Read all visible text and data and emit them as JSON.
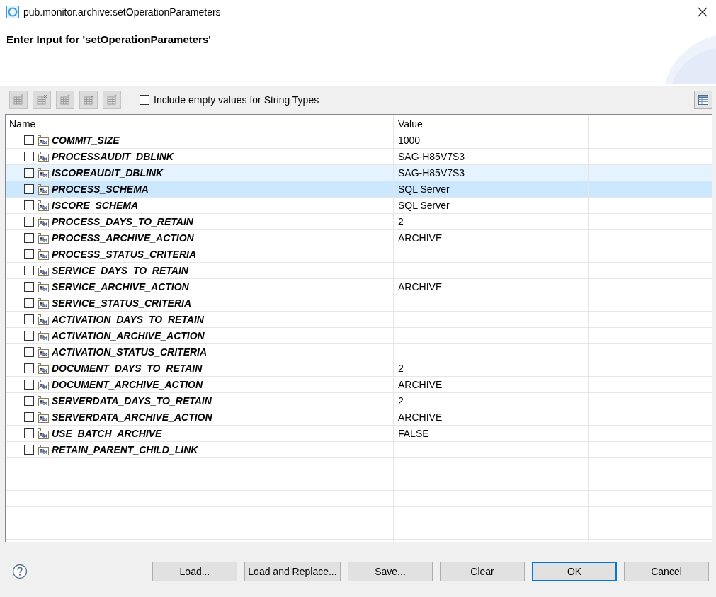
{
  "window": {
    "title": "pub.monitor.archive:setOperationParameters"
  },
  "header": {
    "title": "Enter Input for 'setOperationParameters'"
  },
  "toolbar": {
    "buttons": [
      {
        "disabled": true
      },
      {
        "disabled": true
      },
      {
        "disabled": true
      },
      {
        "disabled": true
      },
      {
        "disabled": true
      }
    ],
    "include_empty": {
      "label": "Include empty values for String Types",
      "checked": false
    }
  },
  "table": {
    "columns": [
      "Name",
      "Value"
    ],
    "rows": [
      {
        "name": "COMMIT_SIZE",
        "value": "1000",
        "checked": false,
        "selected": false,
        "hovered": false
      },
      {
        "name": "PROCESSAUDIT_DBLINK",
        "value": "SAG-H85V7S3",
        "checked": false,
        "selected": false,
        "hovered": false
      },
      {
        "name": "ISCOREAUDIT_DBLINK",
        "value": "SAG-H85V7S3",
        "checked": false,
        "selected": false,
        "hovered": true
      },
      {
        "name": "PROCESS_SCHEMA",
        "value": "SQL Server",
        "checked": false,
        "selected": true,
        "hovered": false
      },
      {
        "name": "ISCORE_SCHEMA",
        "value": "SQL Server",
        "checked": false,
        "selected": false,
        "hovered": false
      },
      {
        "name": "PROCESS_DAYS_TO_RETAIN",
        "value": "2",
        "checked": false,
        "selected": false,
        "hovered": false
      },
      {
        "name": "PROCESS_ARCHIVE_ACTION",
        "value": "ARCHIVE",
        "checked": false,
        "selected": false,
        "hovered": false
      },
      {
        "name": "PROCESS_STATUS_CRITERIA",
        "checked": false,
        "selected": false,
        "hovered": false
      },
      {
        "name": "SERVICE_DAYS_TO_RETAIN",
        "checked": false,
        "selected": false,
        "hovered": false
      },
      {
        "name": "SERVICE_ARCHIVE_ACTION",
        "value": "ARCHIVE",
        "checked": false,
        "selected": false,
        "hovered": false
      },
      {
        "name": "SERVICE_STATUS_CRITERIA",
        "checked": false,
        "selected": false,
        "hovered": false
      },
      {
        "name": "ACTIVATION_DAYS_TO_RETAIN",
        "checked": false,
        "selected": false,
        "hovered": false
      },
      {
        "name": "ACTIVATION_ARCHIVE_ACTION",
        "checked": false,
        "selected": false,
        "hovered": false
      },
      {
        "name": "ACTIVATION_STATUS_CRITERIA",
        "checked": false,
        "selected": false,
        "hovered": false
      },
      {
        "name": "DOCUMENT_DAYS_TO_RETAIN",
        "value": "2",
        "checked": false,
        "selected": false,
        "hovered": false
      },
      {
        "name": "DOCUMENT_ARCHIVE_ACTION",
        "value": "ARCHIVE",
        "checked": false,
        "selected": false,
        "hovered": false
      },
      {
        "name": "SERVERDATA_DAYS_TO_RETAIN",
        "value": "2",
        "checked": false,
        "selected": false,
        "hovered": false
      },
      {
        "name": "SERVERDATA_ARCHIVE_ACTION",
        "value": "ARCHIVE",
        "checked": false,
        "selected": false,
        "hovered": false
      },
      {
        "name": "USE_BATCH_ARCHIVE",
        "value": "FALSE",
        "checked": false,
        "selected": false,
        "hovered": false
      },
      {
        "name": "RETAIN_PARENT_CHILD_LINK",
        "checked": false,
        "selected": false,
        "hovered": false
      }
    ]
  },
  "buttons": [
    {
      "label": "Load...",
      "default": false
    },
    {
      "label": "Load and Replace...",
      "default": false
    },
    {
      "label": "Save...",
      "default": false
    },
    {
      "label": "Clear",
      "default": false
    },
    {
      "label": "OK",
      "default": true
    },
    {
      "label": "Cancel",
      "default": false
    }
  ]
}
